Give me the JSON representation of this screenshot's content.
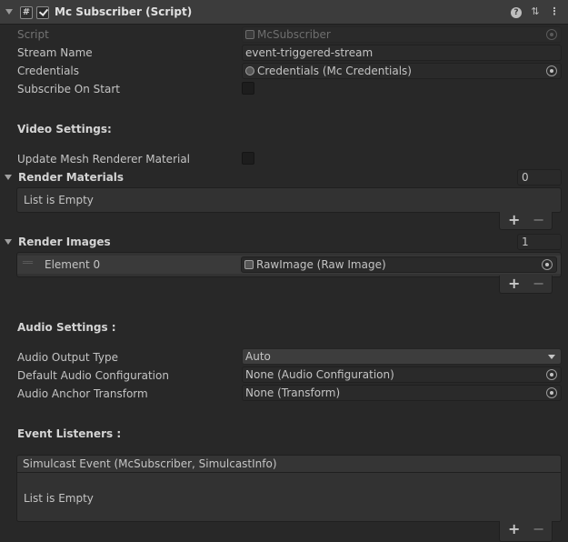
{
  "header": {
    "title": "Mc Subscriber (Script)",
    "enabled": true,
    "icons": [
      "script-icon",
      "help-icon",
      "preset-icon",
      "kebab-icon"
    ]
  },
  "fields": {
    "script": {
      "label": "Script",
      "value": "McSubscriber"
    },
    "stream_name": {
      "label": "Stream Name",
      "value": "event-triggered-stream"
    },
    "credentials": {
      "label": "Credentials",
      "value": "Credentials (Mc Credentials)"
    },
    "subscribe_on_start": {
      "label": "Subscribe On Start",
      "checked": false
    }
  },
  "video": {
    "section": "Video Settings:",
    "update_mesh_label": "Update Mesh Renderer Material",
    "update_mesh_checked": false,
    "render_materials": {
      "label": "Render Materials",
      "count": "0",
      "empty": "List is Empty"
    },
    "render_images": {
      "label": "Render Images",
      "count": "1",
      "elements": [
        {
          "label": "Element 0",
          "value": "RawImage (Raw Image)"
        }
      ]
    }
  },
  "audio": {
    "section": "Audio Settings :",
    "output_type": {
      "label": "Audio Output Type",
      "value": "Auto"
    },
    "default_config": {
      "label": "Default Audio Configuration",
      "value": "None (Audio Configuration)"
    },
    "anchor_transform": {
      "label": "Audio Anchor Transform",
      "value": "None (Transform)"
    }
  },
  "events": {
    "section": "Event Listeners :",
    "header": "Simulcast Event (McSubscriber, SimulcastInfo)",
    "empty": "List is Empty"
  },
  "list_buttons": {
    "add": "+",
    "remove": "−"
  }
}
